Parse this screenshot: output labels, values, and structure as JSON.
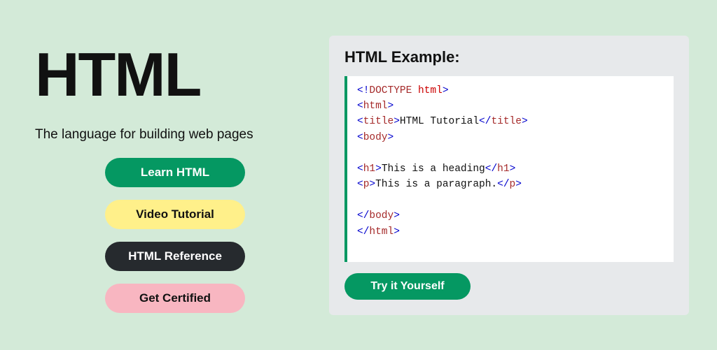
{
  "left": {
    "heading": "HTML",
    "subtitle": "The language for building web pages",
    "buttons": {
      "learn": "Learn HTML",
      "video": "Video Tutorial",
      "reference": "HTML Reference",
      "certified": "Get Certified"
    }
  },
  "example": {
    "title": "HTML Example:",
    "try_label": "Try it Yourself",
    "code": {
      "doctype": "DOCTYPE",
      "doctype_attr": " html",
      "html_tag": "html",
      "title_tag": "title",
      "title_text": "HTML Tutorial",
      "body_tag": "body",
      "h1_tag": "h1",
      "h1_text": "This is a heading",
      "p_tag": "p",
      "p_text": "This is a paragraph."
    }
  }
}
